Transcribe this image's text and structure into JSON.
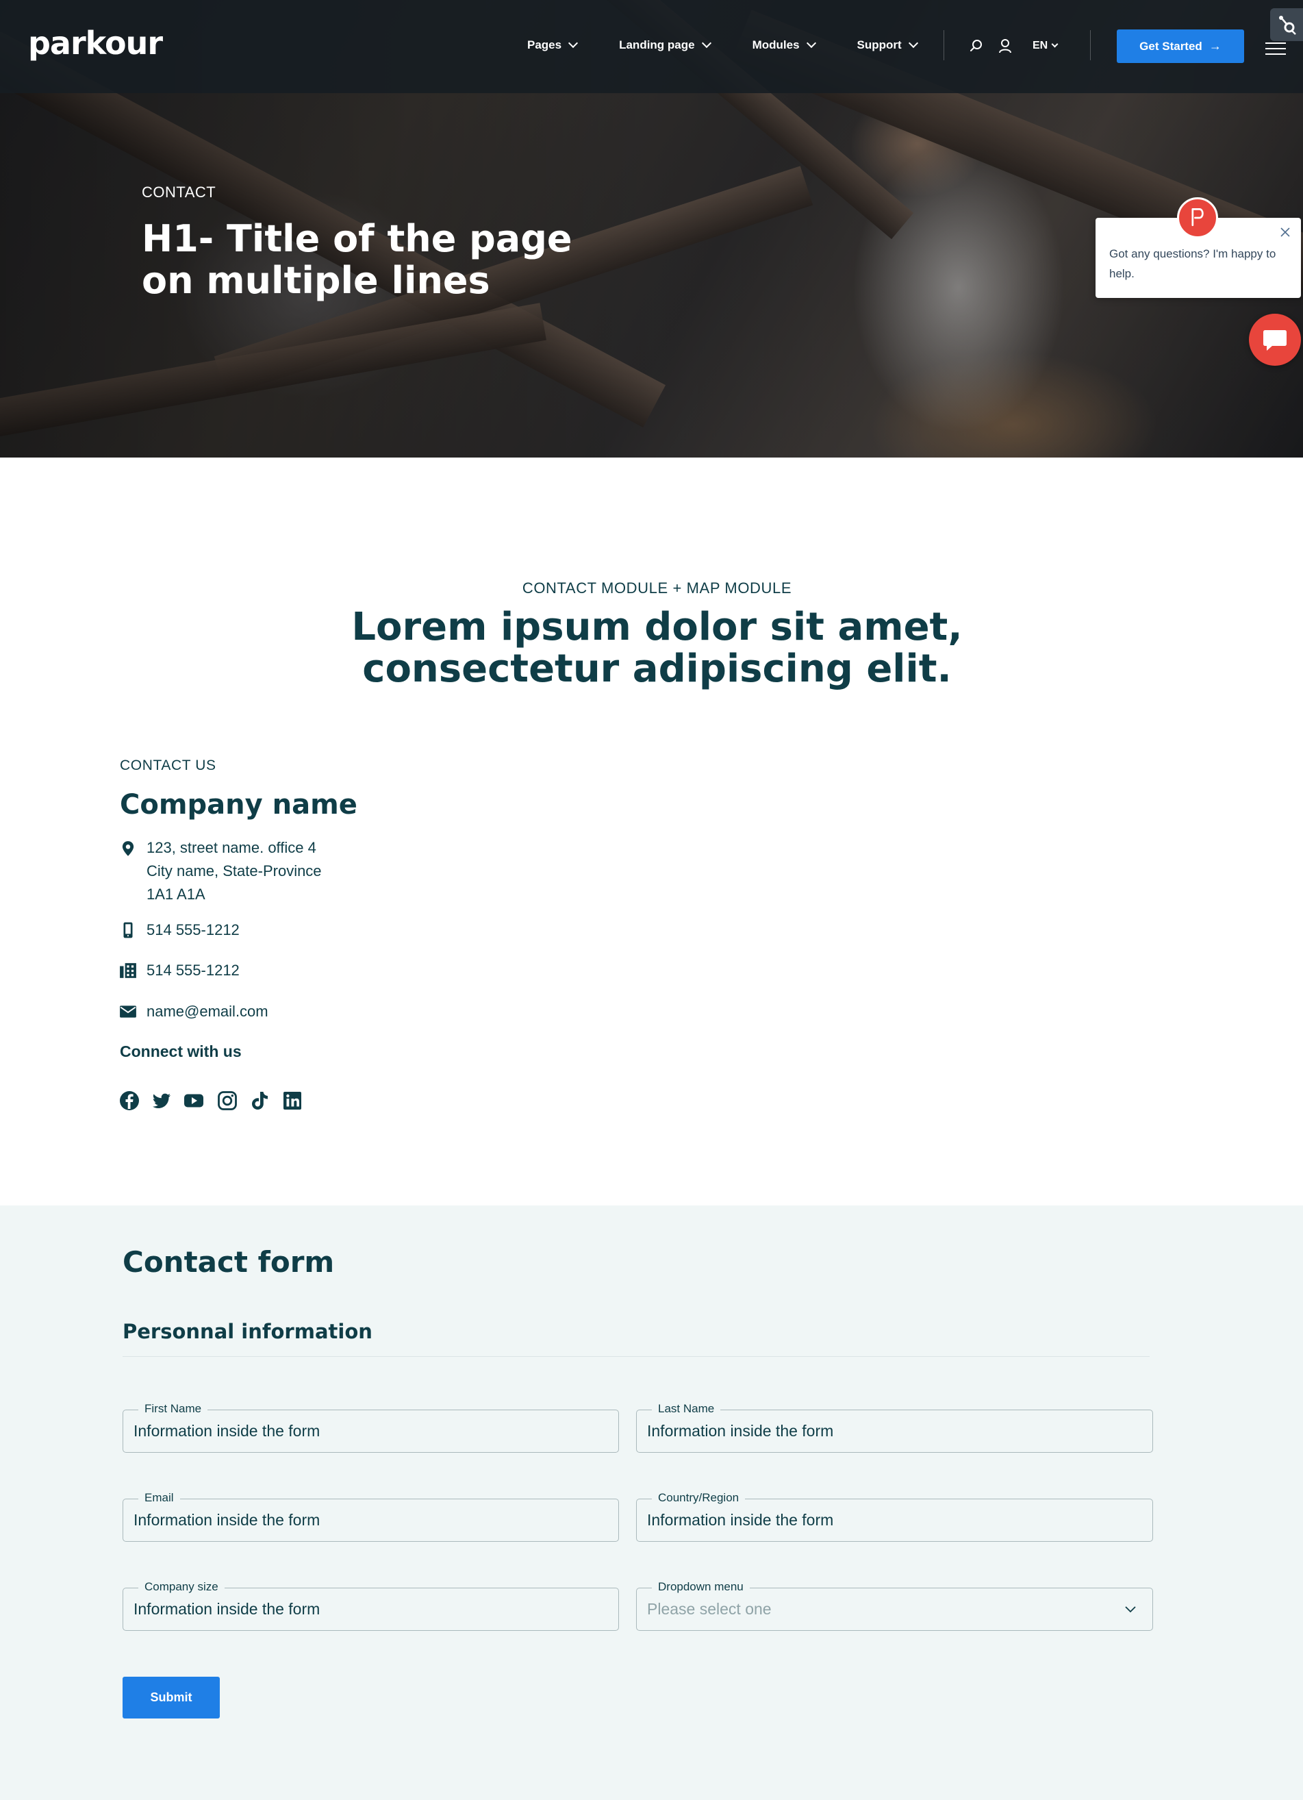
{
  "header": {
    "logo": "parkour",
    "nav": [
      {
        "label": "Pages"
      },
      {
        "label": "Landing page"
      },
      {
        "label": "Modules"
      },
      {
        "label": "Support"
      }
    ],
    "language": "EN",
    "cta_label": "Get Started",
    "colors": {
      "cta": "#1f7fe6"
    }
  },
  "hero": {
    "eyebrow": "CONTACT",
    "title": "H1- Title of the page on multiple lines"
  },
  "chat": {
    "message": "Got any questions? I'm happy to help.",
    "colors": {
      "launcher": "#e8453c"
    }
  },
  "contact_section": {
    "eyebrow": "CONTACT MODULE + MAP MODULE",
    "title": "Lorem ipsum dolor sit amet, consectetur adipiscing elit."
  },
  "contact": {
    "eyebrow": "CONTACT US",
    "company": "Company name",
    "address": [
      "123, street name. office 4",
      "City name, State-Province",
      "1A1 A1A"
    ],
    "phone": "514 555-1212",
    "fax": "514 555-1212",
    "email": "name@email.com",
    "connect_label": "Connect with us",
    "social": [
      "facebook-icon",
      "twitter-icon",
      "youtube-icon",
      "instagram-icon",
      "tiktok-icon",
      "linkedin-icon"
    ]
  },
  "form": {
    "title": "Contact form",
    "subtitle": "Personnal information",
    "fields": {
      "first_name": {
        "label": "First Name",
        "value": "Information inside the form"
      },
      "last_name": {
        "label": "Last Name",
        "value": "Information inside the form"
      },
      "email": {
        "label": "Email",
        "value": "Information inside the form"
      },
      "country": {
        "label": "Country/Region",
        "value": "Information inside the form"
      },
      "company_size": {
        "label": "Company size",
        "value": "Information inside the form"
      },
      "dropdown": {
        "label": "Dropdown menu",
        "placeholder": "Please select one"
      }
    },
    "submit_label": "Submit",
    "colors": {
      "background": "#f0f6f6",
      "heading": "#0f3d47"
    }
  }
}
